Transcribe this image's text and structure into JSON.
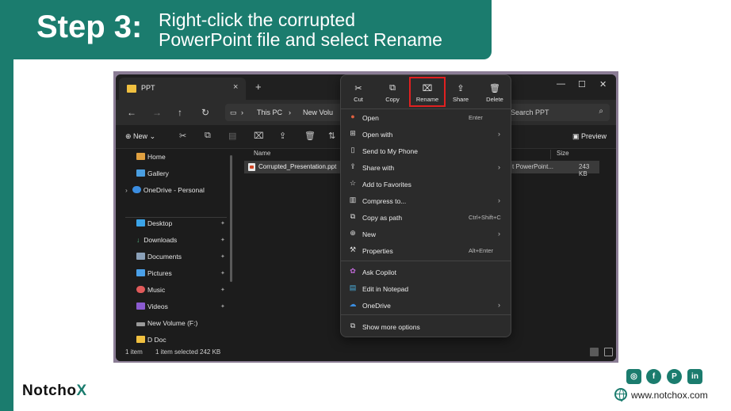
{
  "slide": {
    "step": "Step 3:",
    "instruction_line1": "Right-click the corrupted",
    "instruction_line2": "PowerPoint file and select Rename",
    "brand_prefix": "Notch",
    "brand_mark": "o",
    "brand_suffix": "X",
    "website": "www.notchox.com",
    "social": [
      "instagram-icon",
      "facebook-icon",
      "pinterest-icon",
      "linkedin-icon"
    ],
    "accent_color": "#1b7c6e"
  },
  "explorer": {
    "tab_title": "PPT",
    "tab_close": "×",
    "new_tab": "+",
    "breadcrumb": [
      "This PC",
      "New Volu"
    ],
    "search_placeholder": "Search PPT",
    "toolbar_new": "New",
    "toolbar_preview": "Preview",
    "columns": {
      "name": "Name",
      "size": "Size"
    },
    "nav": {
      "home": "Home",
      "gallery": "Gallery",
      "onedrive": "OneDrive - Personal",
      "desktop": "Desktop",
      "downloads": "Downloads",
      "documents": "Documents",
      "pictures": "Pictures",
      "music": "Music",
      "videos": "Videos",
      "new_volume": "New Volume (F:)",
      "d_doc": "D Doc"
    },
    "file": {
      "name": "Corrupted_Presentation.ppt",
      "type": "t PowerPoint...",
      "size": "243 KB"
    },
    "status": {
      "items": "1 item",
      "selected": "1 item selected  242 KB"
    }
  },
  "context_menu": {
    "quick_actions": {
      "cut": "Cut",
      "copy": "Copy",
      "rename": "Rename",
      "share": "Share",
      "delete": "Delete"
    },
    "items": {
      "open": "Open",
      "open_shortcut": "Enter",
      "open_with": "Open with",
      "send_to_phone": "Send to My Phone",
      "share_with": "Share with",
      "add_favorites": "Add to Favorites",
      "compress": "Compress to...",
      "copy_path": "Copy as path",
      "copy_path_shortcut": "Ctrl+Shift+C",
      "new": "New",
      "properties": "Properties",
      "properties_shortcut": "Alt+Enter",
      "ask_copilot": "Ask Copilot",
      "edit_notepad": "Edit in Notepad",
      "onedrive": "OneDrive",
      "show_more": "Show more options"
    },
    "highlight_color": "#e02020"
  }
}
